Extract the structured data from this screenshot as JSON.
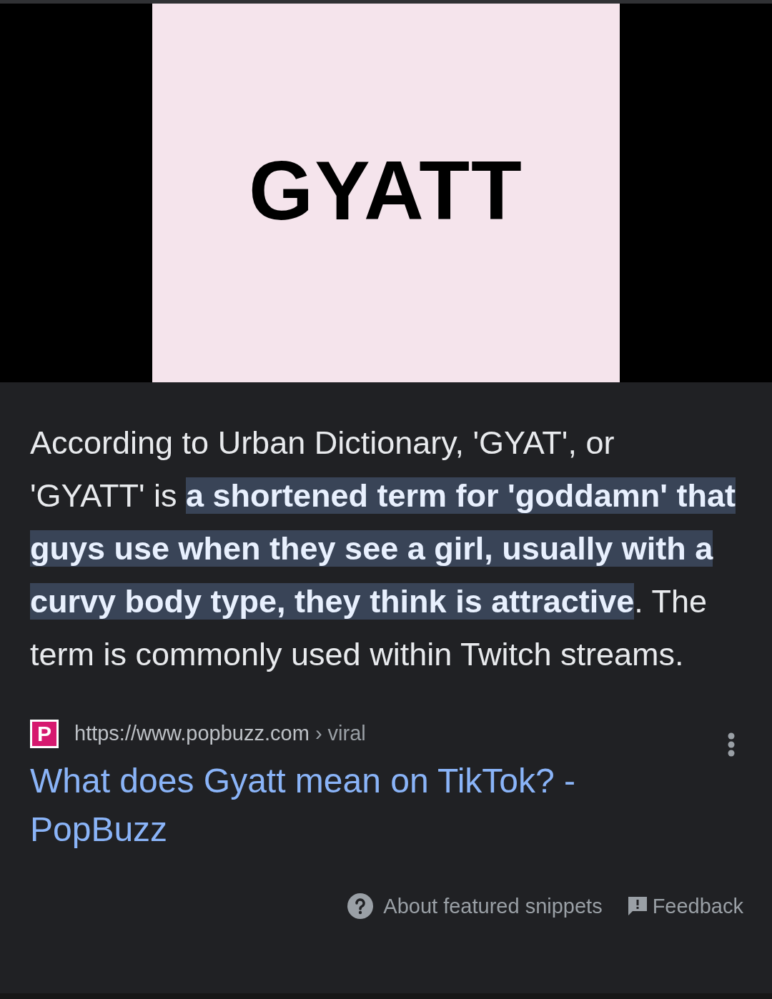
{
  "image": {
    "text": "GYATT"
  },
  "snippet": {
    "text": "According to Urban Dictionary, 'GYAT', or 'GYATT' is **a shortened term for 'goddamn' that guys use when they see a girl, usually with a curvy body type, they think is attractive**. The term is commonly used within Twitch streams."
  },
  "source": {
    "favicon": "P",
    "url": "https://www.popbuzz.com",
    "path": "› viral",
    "title": "What does Gyatt mean on TikTok? - PopBuzz"
  },
  "footer": {
    "about": "About featured snippets",
    "feedback": "Feedback"
  }
}
